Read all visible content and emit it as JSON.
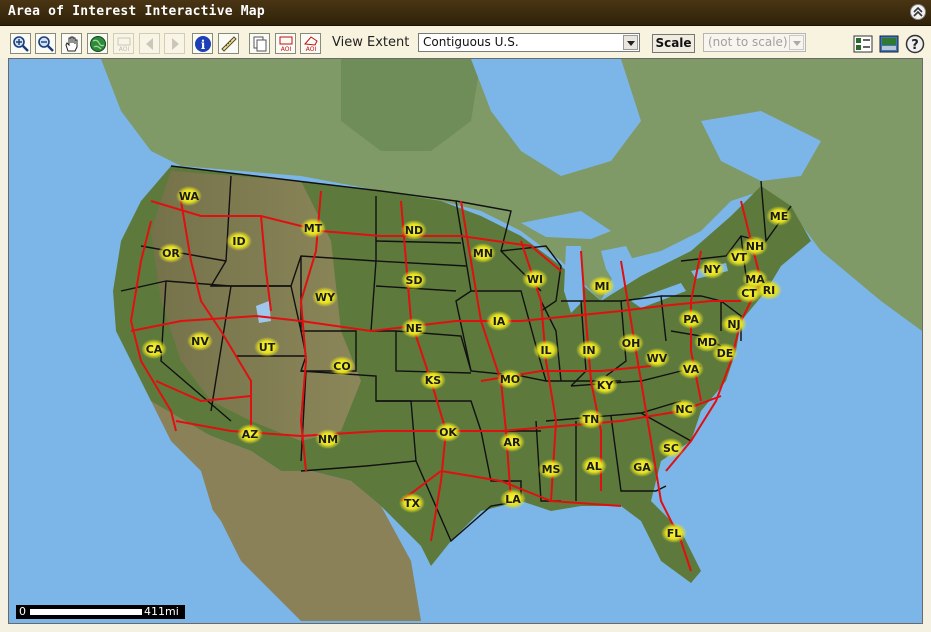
{
  "window": {
    "title": "Area of Interest Interactive Map"
  },
  "toolbar": {
    "tools": [
      {
        "name": "zoom-in-icon",
        "enabled": true
      },
      {
        "name": "zoom-out-icon",
        "enabled": true
      },
      {
        "name": "pan-hand-icon",
        "enabled": true
      },
      {
        "name": "globe-full-extent-icon",
        "enabled": true
      },
      {
        "name": "aoi-disabled-icon",
        "enabled": false
      },
      {
        "name": "back-arrow-icon",
        "enabled": false
      },
      {
        "name": "forward-arrow-icon",
        "enabled": false
      },
      {
        "name": "info-icon",
        "enabled": true
      },
      {
        "name": "measure-ruler-icon",
        "enabled": true
      },
      {
        "name": "copy-icon",
        "enabled": true
      },
      {
        "name": "aoi-box-icon",
        "enabled": true
      },
      {
        "name": "aoi-polygon-icon",
        "enabled": true
      }
    ],
    "view_extent_label": "View Extent",
    "view_extent_value": "Contiguous U.S.",
    "scale_button": "Scale",
    "scale_value": "(not to scale)",
    "right_tools": [
      "layers-icon",
      "overview-map-icon",
      "help-icon"
    ]
  },
  "map": {
    "state_labels": [
      "WA",
      "OR",
      "CA",
      "ID",
      "NV",
      "MT",
      "WY",
      "UT",
      "AZ",
      "CO",
      "NM",
      "ND",
      "SD",
      "NE",
      "KS",
      "OK",
      "TX",
      "MN",
      "IA",
      "MO",
      "AR",
      "LA",
      "WI",
      "IL",
      "MS",
      "MI",
      "IN",
      "KY",
      "TN",
      "AL",
      "OH",
      "GA",
      "FL",
      "SC",
      "NC",
      "VA",
      "WV",
      "PA",
      "MD",
      "DE",
      "NJ",
      "NY",
      "CT",
      "RI",
      "MA",
      "VT",
      "NH",
      "ME"
    ],
    "colors": {
      "water": "#7cb6e8",
      "land": "#5f7a3e",
      "canada": "#7f9b6e",
      "roads": "#e01010",
      "borders": "#111111",
      "label_fill": "#f0ee20"
    }
  },
  "scalebar": {
    "start": "0",
    "distance": "411mi"
  }
}
